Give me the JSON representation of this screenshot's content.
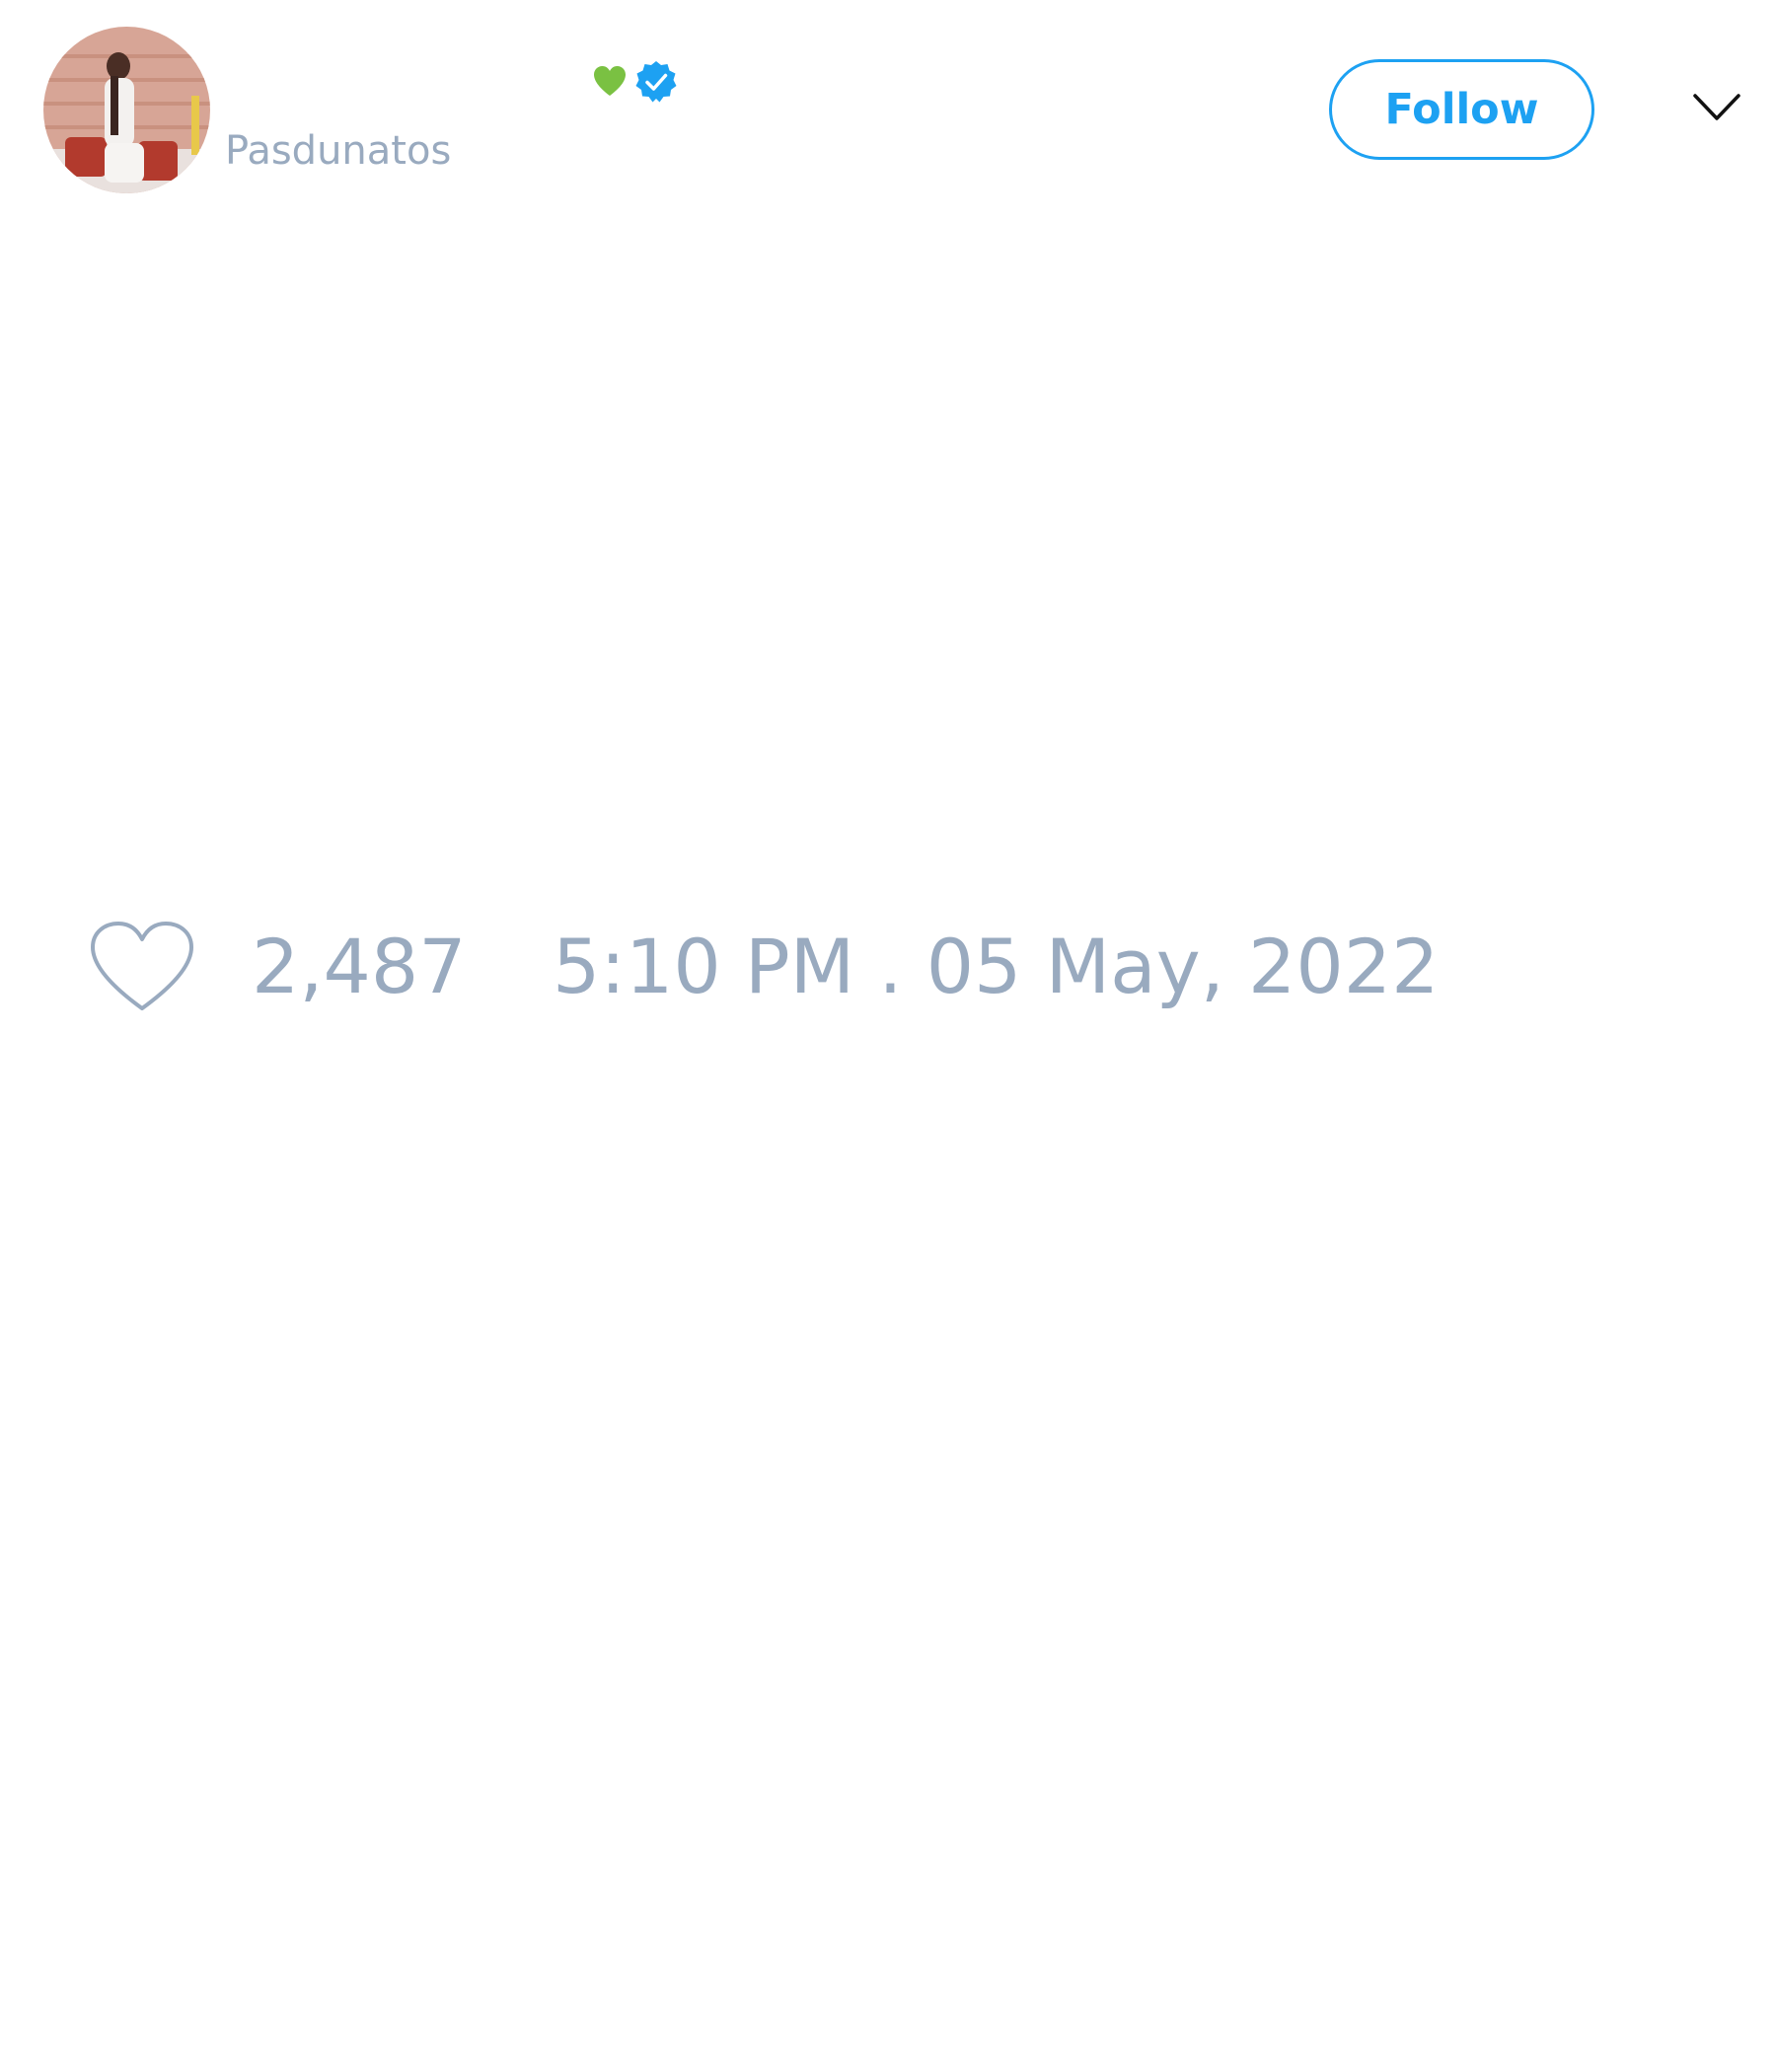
{
  "tweet": {
    "author": {
      "handle": "Pasdunatos",
      "avatar_icon": "profile-photo",
      "name_badges": [
        "green-heart-icon",
        "verified-badge-icon"
      ]
    },
    "follow_button_label": "Follow",
    "menu_icon": "chevron-down-icon",
    "like_icon": "heart-outline-icon",
    "like_count": "2,487",
    "timestamp": "5:10 PM . 05 May, 2022"
  },
  "colors": {
    "accent": "#1da1f2",
    "muted_text": "#99aabf",
    "heart_emoji": "#7ac142",
    "background": "#ffffff"
  }
}
